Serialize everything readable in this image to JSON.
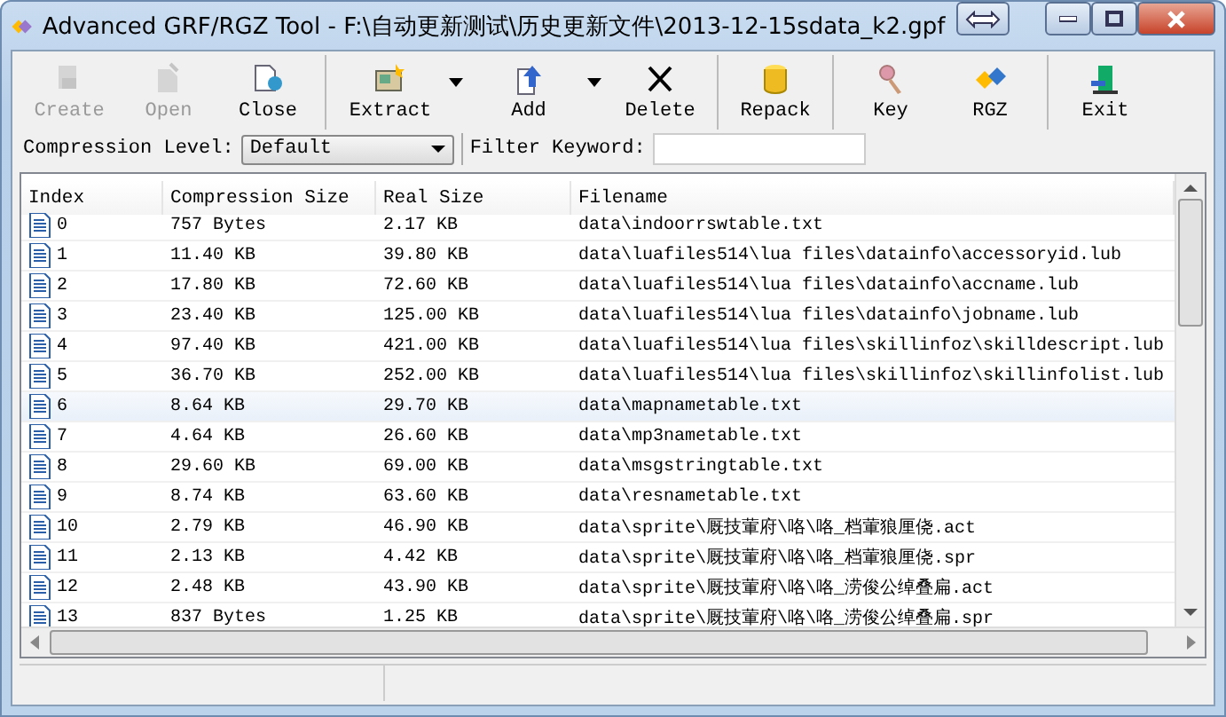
{
  "window": {
    "title": "Advanced GRF/RGZ Tool - F:\\自动更新测试\\历史更新文件\\2013-12-15sdata_k2.gpf"
  },
  "toolbar": {
    "groups": [
      [
        {
          "label": "Create",
          "disabled": true,
          "dropdown": false
        },
        {
          "label": "Open",
          "disabled": true,
          "dropdown": false
        },
        {
          "label": "Close",
          "disabled": false,
          "dropdown": false
        }
      ],
      [
        {
          "label": "Extract",
          "disabled": false,
          "dropdown": true
        },
        {
          "label": "Add",
          "disabled": false,
          "dropdown": true
        },
        {
          "label": "Delete",
          "disabled": false,
          "dropdown": false
        }
      ],
      [
        {
          "label": "Repack",
          "disabled": false,
          "dropdown": false
        }
      ],
      [
        {
          "label": "Key",
          "disabled": false,
          "dropdown": false
        },
        {
          "label": "RGZ",
          "disabled": false,
          "dropdown": false
        }
      ],
      [
        {
          "label": "Exit",
          "disabled": false,
          "dropdown": false
        }
      ]
    ]
  },
  "options": {
    "compression_label": "Compression Level:",
    "compression_value": "Default",
    "filter_label": "Filter Keyword:"
  },
  "table": {
    "columns": [
      "Index",
      "Compression Size",
      "Real Size",
      "Filename"
    ],
    "rows": [
      {
        "index": "0",
        "compression_size": "757 Bytes",
        "real_size": "2.17 KB",
        "filename": "data\\indoorrswtable.txt",
        "selected": false
      },
      {
        "index": "1",
        "compression_size": "11.40 KB",
        "real_size": "39.80 KB",
        "filename": "data\\luafiles514\\lua files\\datainfo\\accessoryid.lub",
        "selected": false
      },
      {
        "index": "2",
        "compression_size": "17.80 KB",
        "real_size": "72.60 KB",
        "filename": "data\\luafiles514\\lua files\\datainfo\\accname.lub",
        "selected": false
      },
      {
        "index": "3",
        "compression_size": "23.40 KB",
        "real_size": "125.00 KB",
        "filename": "data\\luafiles514\\lua files\\datainfo\\jobname.lub",
        "selected": false
      },
      {
        "index": "4",
        "compression_size": "97.40 KB",
        "real_size": "421.00 KB",
        "filename": "data\\luafiles514\\lua files\\skillinfoz\\skilldescript.lub",
        "selected": false
      },
      {
        "index": "5",
        "compression_size": "36.70 KB",
        "real_size": "252.00 KB",
        "filename": "data\\luafiles514\\lua files\\skillinfoz\\skillinfolist.lub",
        "selected": false
      },
      {
        "index": "6",
        "compression_size": "8.64 KB",
        "real_size": "29.70 KB",
        "filename": "data\\mapnametable.txt",
        "selected": true
      },
      {
        "index": "7",
        "compression_size": "4.64 KB",
        "real_size": "26.60 KB",
        "filename": "data\\mp3nametable.txt",
        "selected": false
      },
      {
        "index": "8",
        "compression_size": "29.60 KB",
        "real_size": "69.00 KB",
        "filename": "data\\msgstringtable.txt",
        "selected": false
      },
      {
        "index": "9",
        "compression_size": "8.74 KB",
        "real_size": "63.60 KB",
        "filename": "data\\resnametable.txt",
        "selected": false
      },
      {
        "index": "10",
        "compression_size": "2.79 KB",
        "real_size": "46.90 KB",
        "filename": "data\\sprite\\厩技葷府\\咯\\咯_档葷狼厘侥.act",
        "selected": false
      },
      {
        "index": "11",
        "compression_size": "2.13 KB",
        "real_size": "4.42 KB",
        "filename": "data\\sprite\\厩技葷府\\咯\\咯_档葷狼厘侥.spr",
        "selected": false
      },
      {
        "index": "12",
        "compression_size": "2.48 KB",
        "real_size": "43.90 KB",
        "filename": "data\\sprite\\厩技葷府\\咯\\咯_涝俊公绰叠扁.act",
        "selected": false
      },
      {
        "index": "13",
        "compression_size": "837 Bytes",
        "real_size": "1.25 KB",
        "filename": "data\\sprite\\厩技葷府\\咯\\咯_涝俊公绰叠扁.spr",
        "selected": false
      }
    ]
  }
}
